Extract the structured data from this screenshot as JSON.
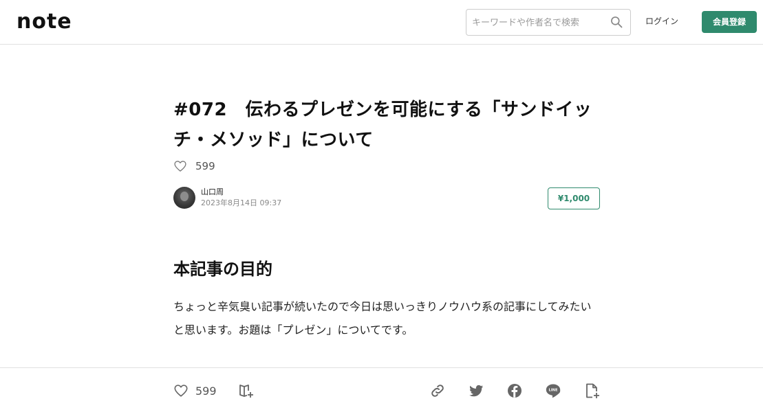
{
  "header": {
    "logo": "note",
    "search_placeholder": "キーワードや作者名で検索",
    "login_label": "ログイン",
    "signup_label": "会員登録",
    "accent_color": "#2f8a6d"
  },
  "article": {
    "title": "#072　伝わるプレゼンを可能にする「サンドイッチ・メソッド」について",
    "like_count": "599",
    "author_name": "山口周",
    "published_at": "2023年8月14日 09:37",
    "price": "¥1,000",
    "section_heading": "本記事の目的",
    "body": "ちょっと辛気臭い記事が続いたので今日は思いっきりノウハウ系の記事にしてみたいと思います。お題は「プレゼン」についてです。"
  },
  "bottom_bar": {
    "like_count": "599",
    "icons": [
      "heart-icon",
      "magazine-add-icon",
      "link-icon",
      "twitter-icon",
      "facebook-icon",
      "line-icon",
      "note-add-icon"
    ]
  }
}
